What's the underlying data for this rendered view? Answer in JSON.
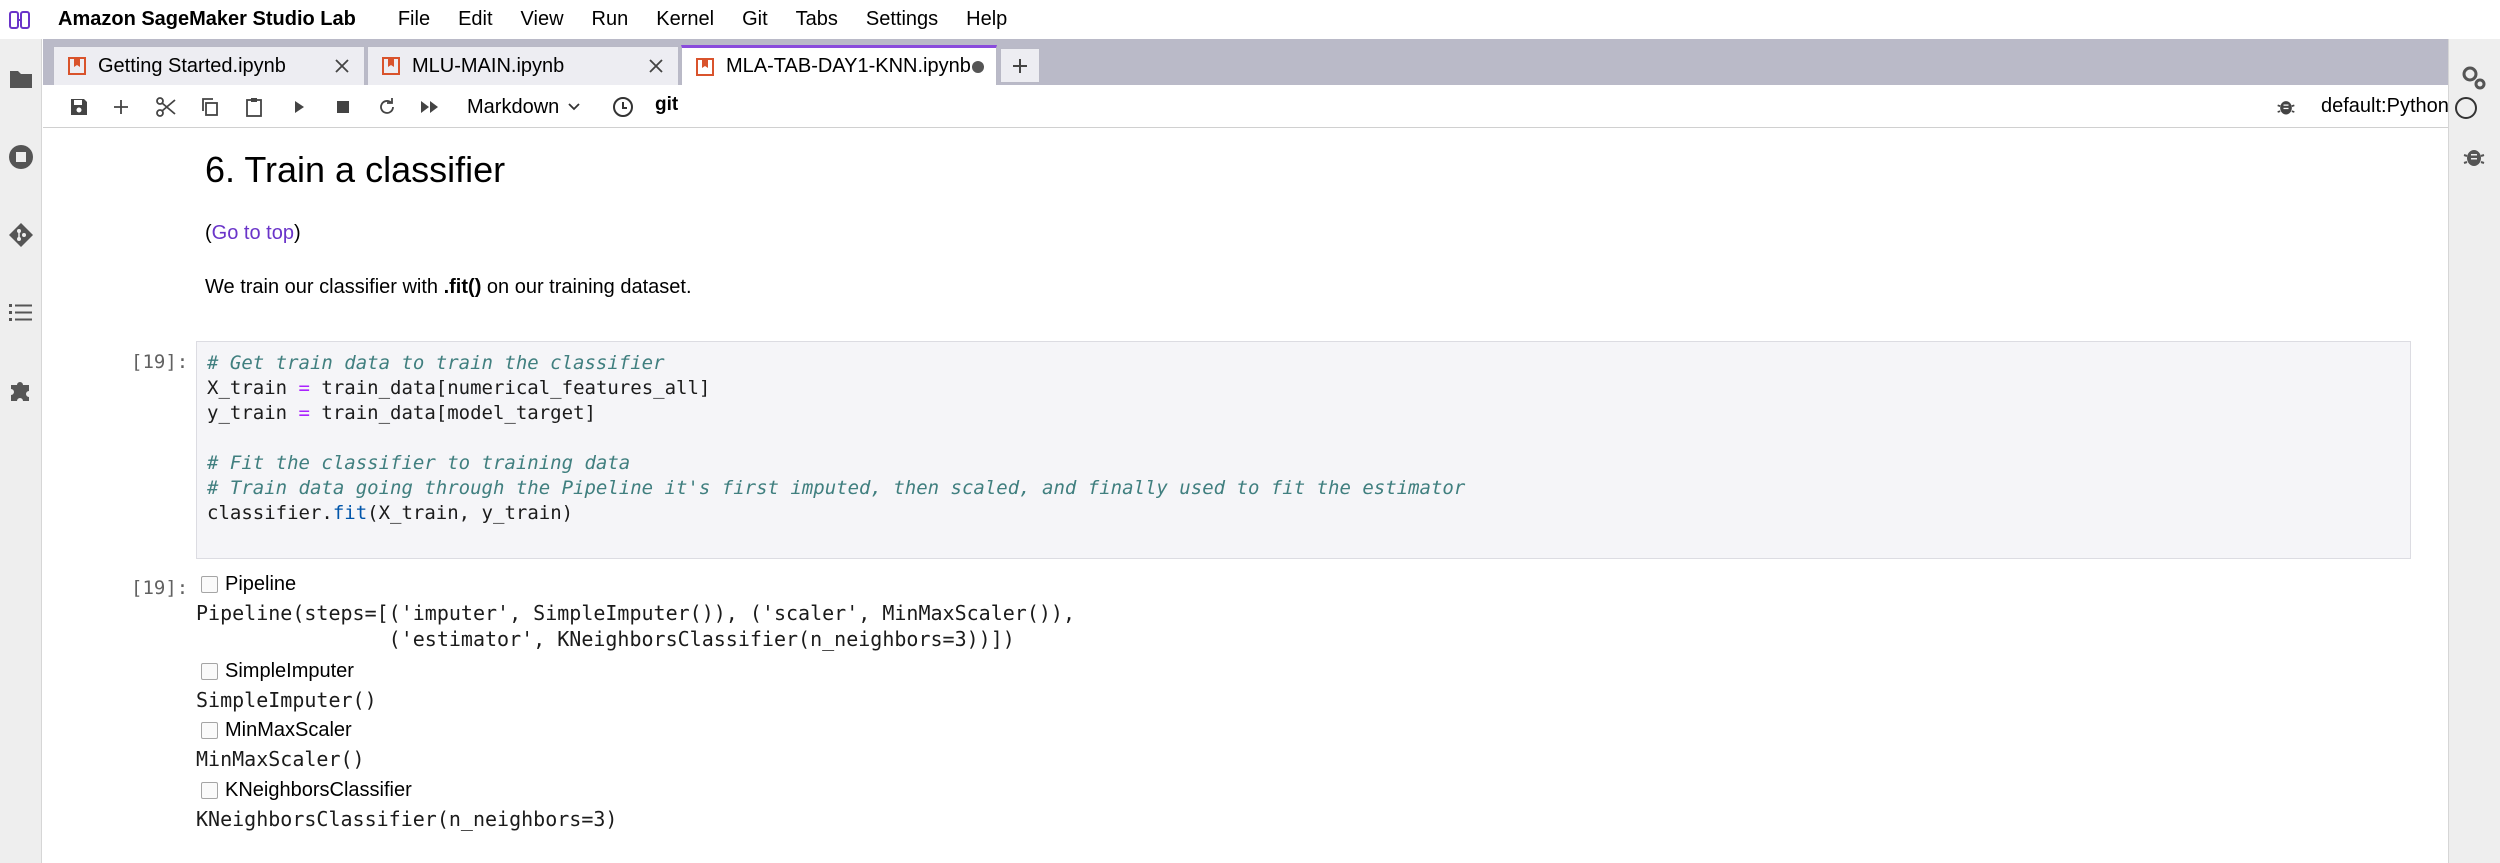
{
  "app": {
    "title": "Amazon SageMaker Studio Lab"
  },
  "menu": [
    "File",
    "Edit",
    "View",
    "Run",
    "Kernel",
    "Git",
    "Tabs",
    "Settings",
    "Help"
  ],
  "tabs": [
    {
      "label": "Getting Started.ipynb",
      "active": false,
      "dirty": false
    },
    {
      "label": "MLU-MAIN.ipynb",
      "active": false,
      "dirty": false
    },
    {
      "label": "MLA-TAB-DAY1-KNN.ipynb",
      "active": true,
      "dirty": true
    }
  ],
  "toolbar": {
    "cell_type": "Markdown",
    "git_label": "git",
    "kernel_name": "default:Python"
  },
  "notebook": {
    "heading": "6. Train a classifier",
    "go_top": {
      "open": "(",
      "link": "Go to top",
      "close": ")"
    },
    "intro": {
      "before": "We train our classifier with ",
      "bold": ".fit()",
      "after": " on our training dataset."
    },
    "cell": {
      "prompt": "[19]:",
      "code": {
        "c1": "# Get train data to train the classifier",
        "l2_a": "X_train ",
        "l2_op": "=",
        "l2_b": " train_data[numerical_features_all]",
        "l3_a": "y_train ",
        "l3_op": "=",
        "l3_b": " train_data[model_target]",
        "c5": "# Fit the classifier to training data",
        "c6": "# Train data going through the Pipeline it's first imputed, then scaled, and finally used to fit the estimator",
        "l7_a": "classifier.",
        "l7_fn": "fit",
        "l7_b": "(X_train, y_train)"
      }
    },
    "output": {
      "prompt": "[19]:",
      "pipeline_label": "Pipeline",
      "pipeline_repr_1": "Pipeline(steps=[('imputer', SimpleImputer()), ('scaler', MinMaxScaler()),",
      "pipeline_repr_2": "                ('estimator', KNeighborsClassifier(n_neighbors=3))])",
      "imputer_label": "SimpleImputer",
      "imputer_repr": "SimpleImputer()",
      "scaler_label": "MinMaxScaler",
      "scaler_repr": "MinMaxScaler()",
      "knn_label": "KNeighborsClassifier",
      "knn_repr": "KNeighborsClassifier(n_neighbors=3)"
    }
  },
  "colors": {
    "accent": "#8a4bdc",
    "link": "#6a34c9",
    "comment": "#407f7f",
    "operator": "#aa22ff",
    "tab_icon": "#d9532c"
  }
}
